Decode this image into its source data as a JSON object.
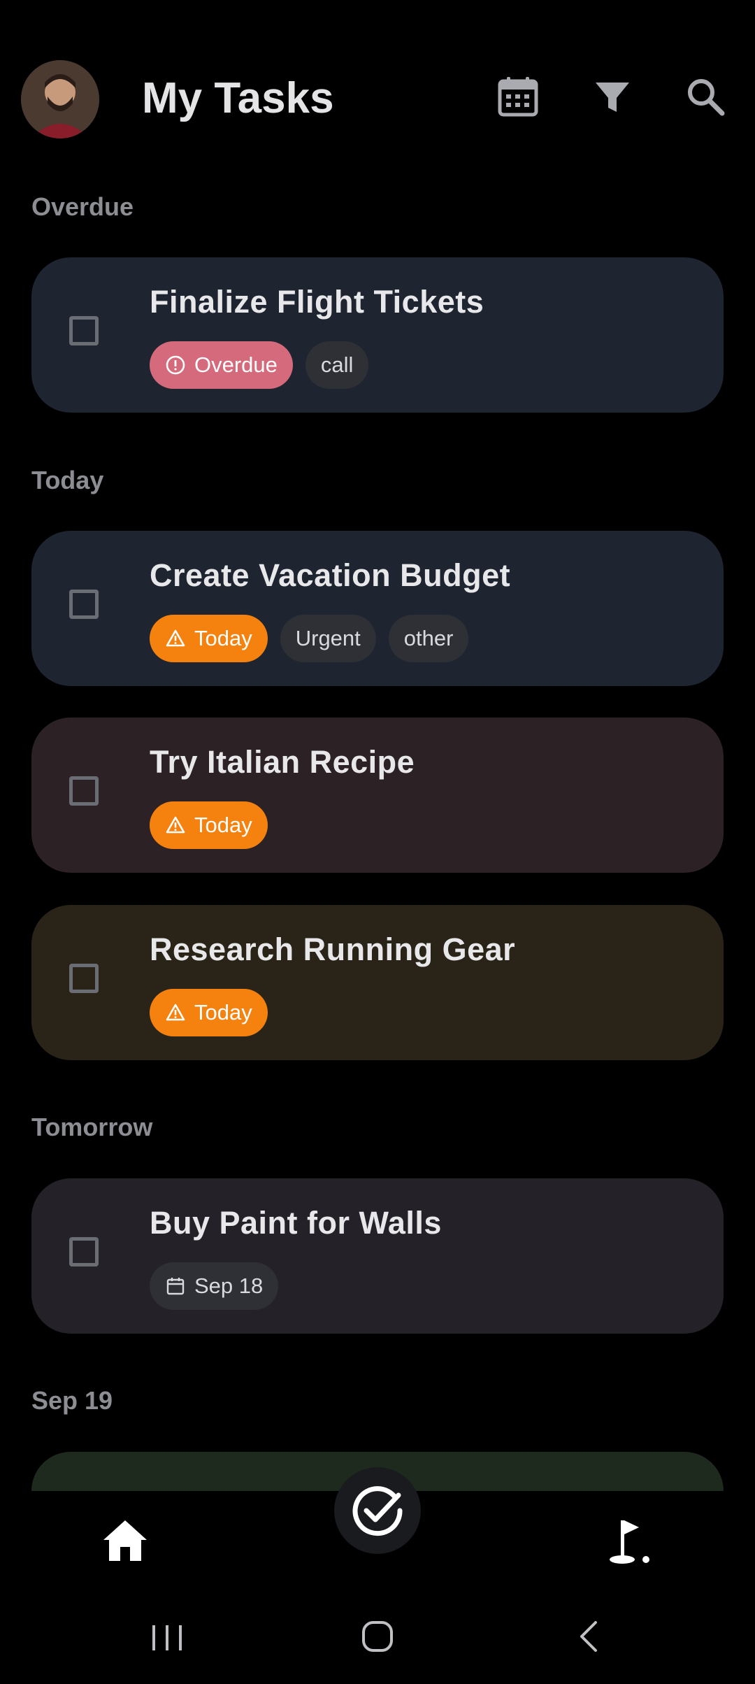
{
  "header": {
    "title": "My Tasks",
    "avatar_icon": "user-avatar",
    "calendar_icon": "calendar-icon",
    "filter_icon": "filter-icon",
    "search_icon": "search-icon"
  },
  "sections": {
    "overdue": "Overdue",
    "today": "Today",
    "tomorrow": "Tomorrow",
    "sep19": "Sep 19"
  },
  "tasks": [
    {
      "title": "Finalize Flight Tickets",
      "status_label": "Overdue",
      "tags": [
        "call"
      ],
      "bg": "#1e2530"
    },
    {
      "title": "Create Vacation Budget",
      "status_label": "Today",
      "tags": [
        "Urgent",
        "other"
      ],
      "bg": "#1e2530"
    },
    {
      "title": "Try Italian Recipe",
      "status_label": "Today",
      "tags": [],
      "bg": "#2c2226"
    },
    {
      "title": "Research Running Gear",
      "status_label": "Today",
      "tags": [],
      "bg": "#2a2418"
    },
    {
      "title": "Buy Paint for Walls",
      "date_label": "Sep 18",
      "tags": [],
      "bg": "#242228"
    }
  ],
  "colors": {
    "overdue_chip": "#d46a7c",
    "today_chip": "#f5820e",
    "tag_chip": "#2e3036",
    "background": "#000000",
    "peek_card": "#1f2a1f"
  },
  "nav": {
    "home_icon": "home-icon",
    "fab_icon": "check-circle-icon",
    "golf_icon": "golf-flag-icon"
  },
  "system_nav": {
    "recents_icon": "recents-icon",
    "home_icon": "home-circle-icon",
    "back_icon": "back-icon"
  }
}
